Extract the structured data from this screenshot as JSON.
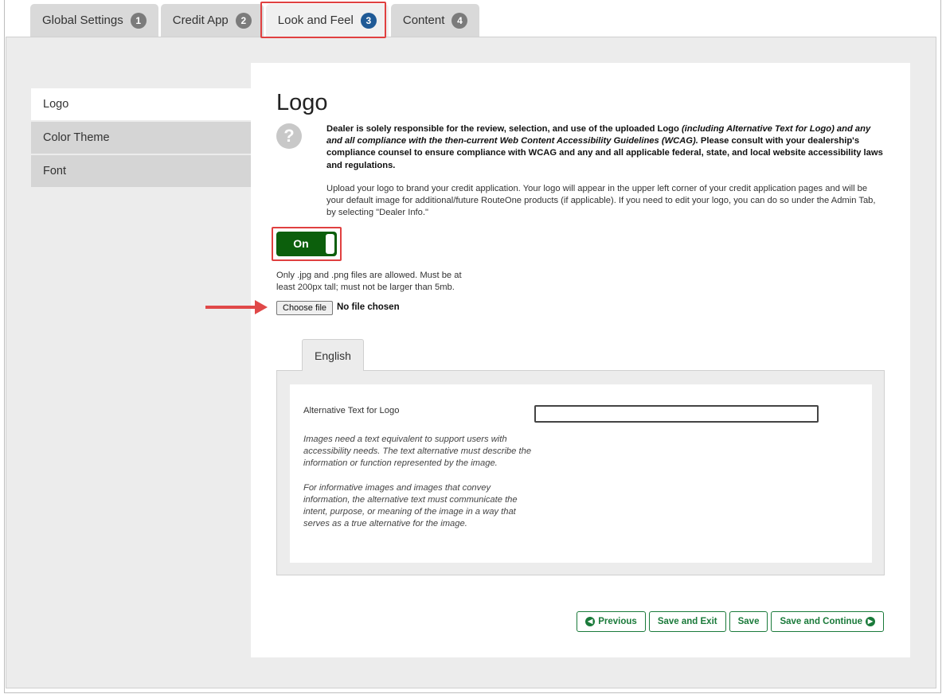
{
  "tabs": [
    {
      "label": "Global Settings",
      "num": "1"
    },
    {
      "label": "Credit App",
      "num": "2"
    },
    {
      "label": "Look and Feel",
      "num": "3"
    },
    {
      "label": "Content",
      "num": "4"
    }
  ],
  "sidebar": {
    "items": [
      {
        "label": "Logo"
      },
      {
        "label": "Color Theme"
      },
      {
        "label": "Font"
      }
    ]
  },
  "main": {
    "title": "Logo",
    "disclaimer_a": "Dealer is solely responsible for the review, selection, and use of the uploaded Logo ",
    "disclaimer_b": "(including Alternative Text for Logo) and any and all compliance with the then-current Web Content Accessibility Guidelines (WCAG).",
    "disclaimer_c": " Please consult with your dealership's compliance counsel to ensure compliance with WCAG and any and all applicable federal, state, and local website accessibility laws and regulations.",
    "upload_info": "Upload your logo to brand your credit application. Your logo will appear in the upper left corner of your credit application pages and will be your default image for additional/future RouteOne products (if applicable). If you need to edit your logo, you can do so under the Admin Tab, by selecting \"Dealer Info.\"",
    "toggle_label": "On",
    "file_note": "Only .jpg and .png files are allowed. Must be at least 200px tall; must not be larger than 5mb.",
    "choose_file": "Choose file",
    "no_file": "No file chosen"
  },
  "language": {
    "tab": "English",
    "alt_label": "Alternative Text for Logo",
    "alt_value": "",
    "help1": "Images need a text equivalent to support users with accessibility needs. The text alternative must describe the information or function represented by the image.",
    "help2": "For informative images and images that convey information, the alternative text must communicate the intent, purpose, or meaning of the image in a way that serves as a true alternative for the image."
  },
  "buttons": {
    "previous": "Previous",
    "save_exit": "Save and Exit",
    "save": "Save",
    "save_continue": "Save and Continue"
  },
  "colors": {
    "toggle_on": "#0c5f0c",
    "button_green": "#1a7a3a",
    "active_step": "#1f5a96",
    "highlight_red": "#e04040"
  }
}
